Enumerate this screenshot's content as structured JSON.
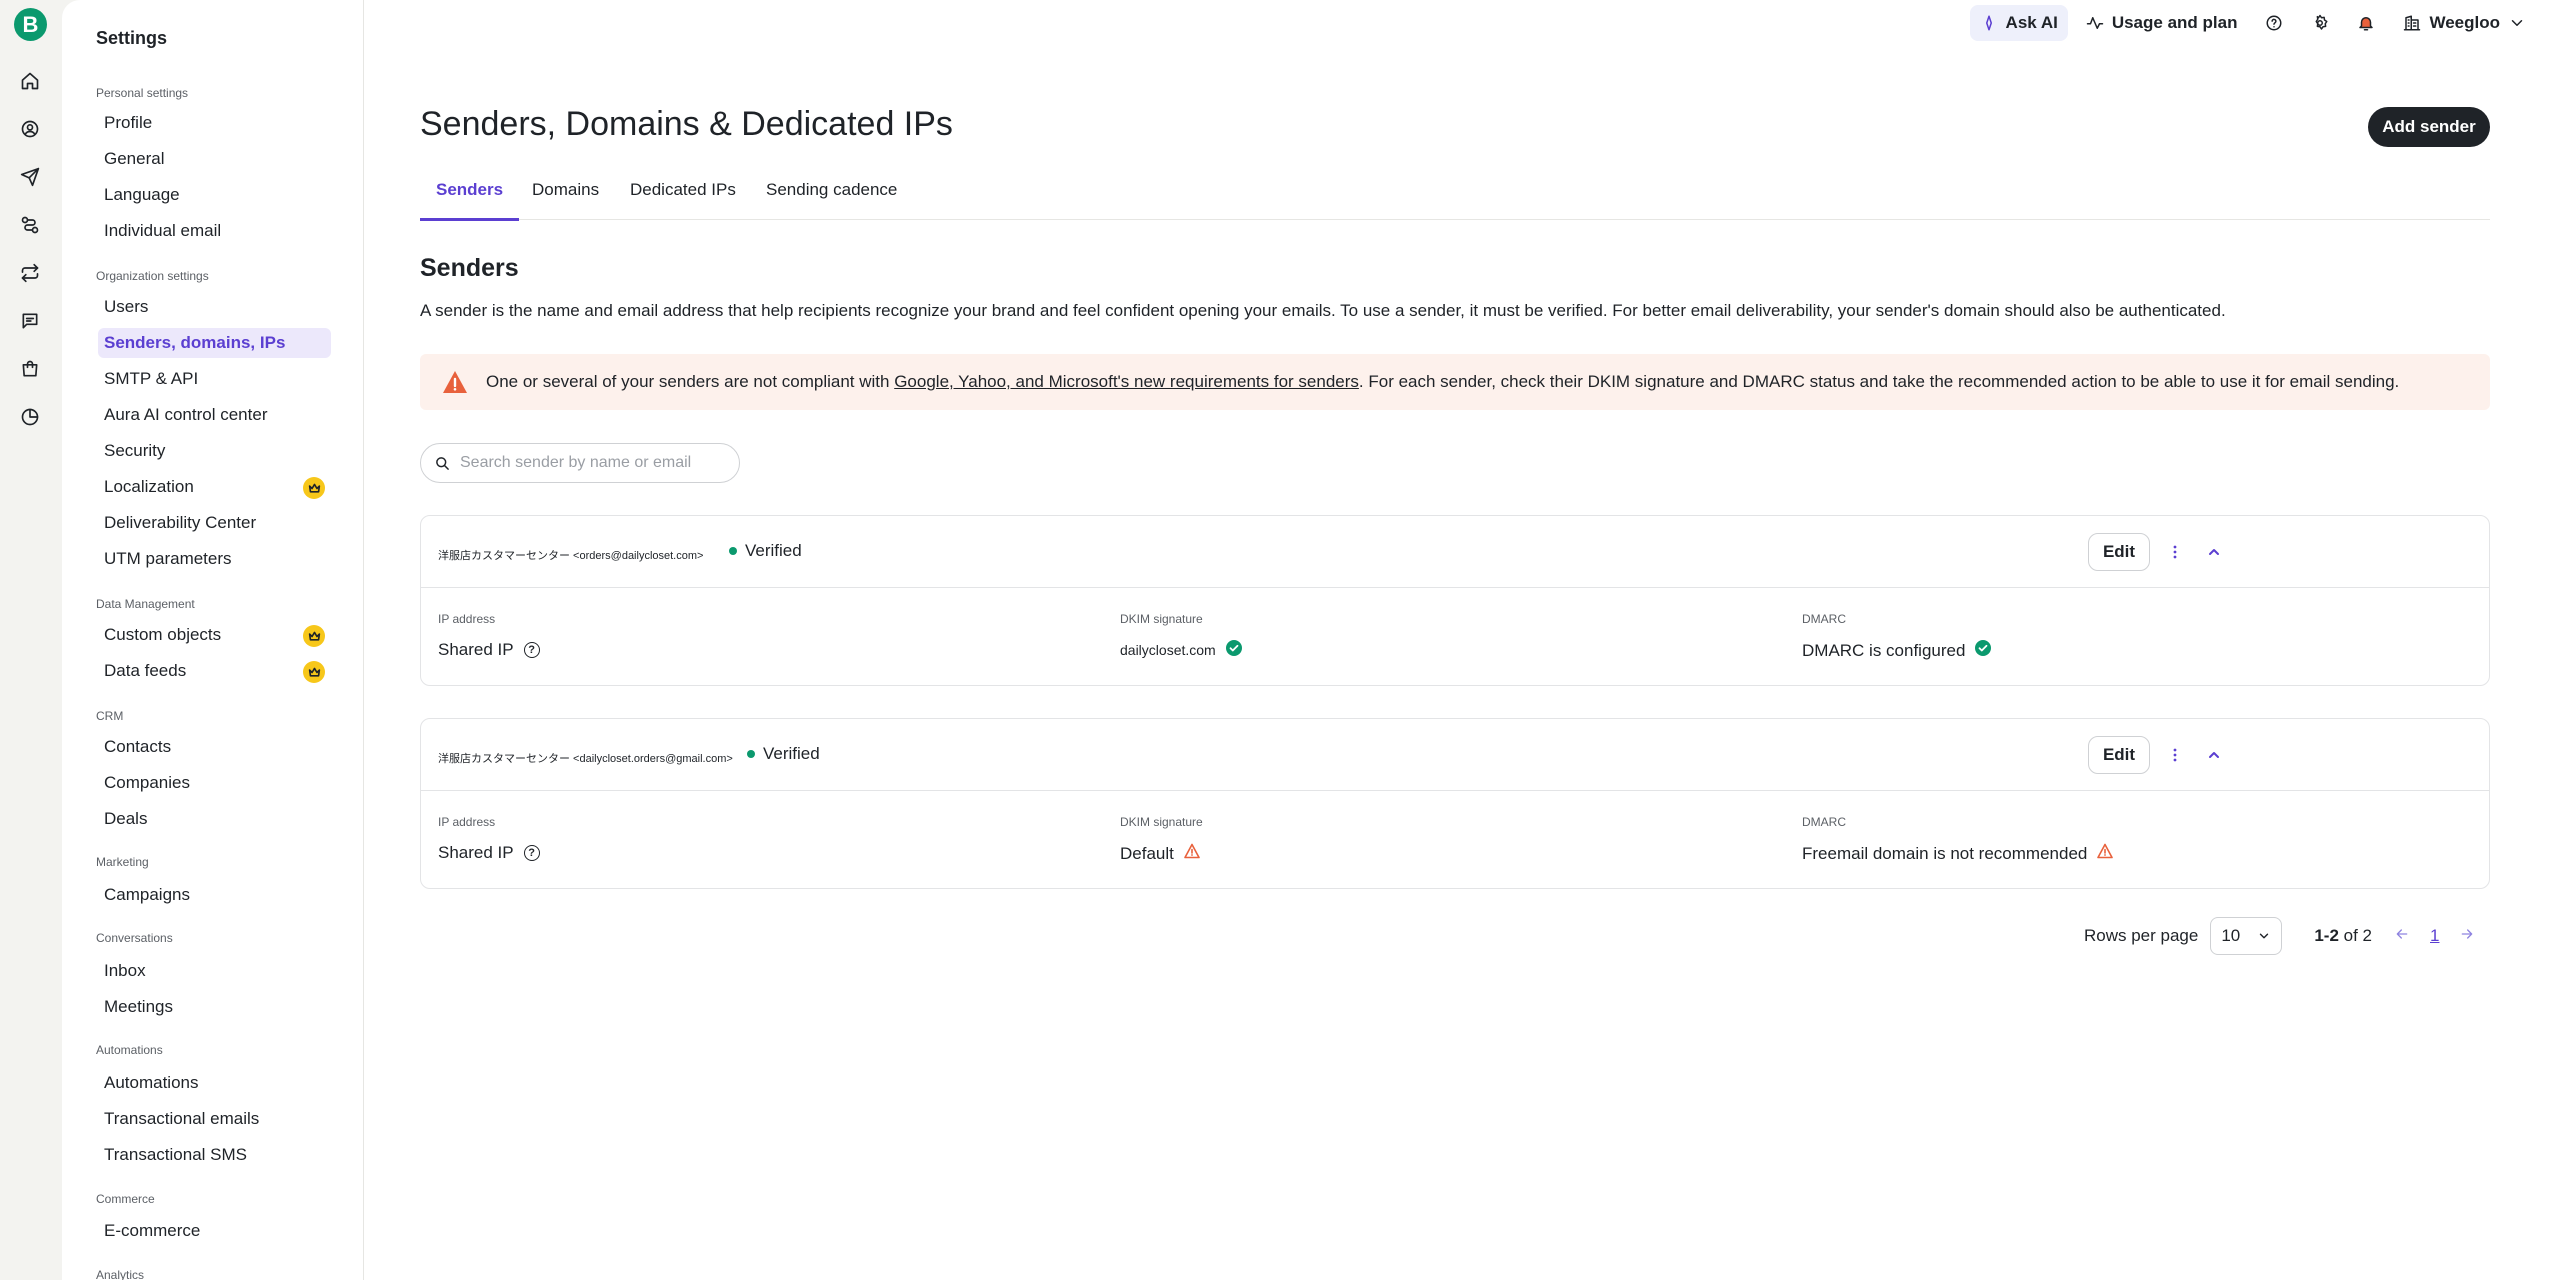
{
  "rail": {
    "logo": "B",
    "icons": [
      "home-icon",
      "contacts-icon",
      "campaigns-icon",
      "automations-icon",
      "transactional-icon",
      "conversations-icon",
      "ecommerce-icon",
      "analytics-icon"
    ]
  },
  "sidebar": {
    "title": "Settings",
    "sections": {
      "personal": "Personal settings",
      "organization": "Organization settings",
      "data": "Data Management",
      "crm": "CRM",
      "marketing": "Marketing",
      "conversations": "Conversations",
      "automations": "Automations",
      "commerce": "Commerce",
      "analytics": "Analytics"
    },
    "items": {
      "profile": "Profile",
      "general": "General",
      "language": "Language",
      "individual_email": "Individual email",
      "users": "Users",
      "senders": "Senders, domains, IPs",
      "smtp": "SMTP & API",
      "aura": "Aura AI control center",
      "security": "Security",
      "localization": "Localization",
      "deliverability": "Deliverability Center",
      "utm": "UTM parameters",
      "custom_objects": "Custom objects",
      "data_feeds": "Data feeds",
      "contacts": "Contacts",
      "companies": "Companies",
      "deals": "Deals",
      "campaigns": "Campaigns",
      "inbox": "Inbox",
      "meetings": "Meetings",
      "automations": "Automations",
      "transactional_emails": "Transactional emails",
      "transactional_sms": "Transactional SMS",
      "ecommerce": "E-commerce"
    }
  },
  "topbar": {
    "ask_ai": "Ask AI",
    "usage": "Usage and plan",
    "account": "Weegloo"
  },
  "page": {
    "title": "Senders, Domains & Dedicated IPs",
    "add_button": "Add sender",
    "tabs": [
      "Senders",
      "Domains",
      "Dedicated IPs",
      "Sending cadence"
    ],
    "section_title": "Senders",
    "description": "A sender is the name and email address that help recipients recognize your brand and feel confident opening your emails. To use a sender, it must be verified. For better email deliverability, your sender's domain should also be authenticated.",
    "alert": {
      "before": "One or several of your senders are not compliant with ",
      "link": "Google, Yahoo, and Microsoft's new requirements for senders",
      "after": ". For each sender, check their DKIM signature and DMARC status and take the recommended action to be able to use it for email sending."
    },
    "search_placeholder": "Search sender by name or email"
  },
  "senders": [
    {
      "name": "洋服店カスタマーセンター <orders@dailycloset.com>",
      "status": "Verified",
      "edit": "Edit",
      "ip_label": "IP address",
      "ip_value": "Shared IP",
      "dkim_label": "DKIM signature",
      "dkim_value": "dailycloset.com",
      "dkim_state": "ok",
      "dmarc_label": "DMARC",
      "dmarc_value": "DMARC is configured",
      "dmarc_state": "ok"
    },
    {
      "name": "洋服店カスタマーセンター <dailycloset.orders@gmail.com>",
      "status": "Verified",
      "edit": "Edit",
      "ip_label": "IP address",
      "ip_value": "Shared IP",
      "dkim_label": "DKIM signature",
      "dkim_value": "Default",
      "dkim_state": "warning",
      "dmarc_label": "DMARC",
      "dmarc_value": "Freemail domain is not recommended",
      "dmarc_state": "warning"
    }
  ],
  "pagination": {
    "rows_label": "Rows per page",
    "rows_value": "10",
    "range": "1-2",
    "of_label": "of 2",
    "page": "1"
  },
  "colors": {
    "accent": "#5b3fd1",
    "success": "#0b996e",
    "warning": "#e8613c",
    "premium": "#f7c71a"
  }
}
